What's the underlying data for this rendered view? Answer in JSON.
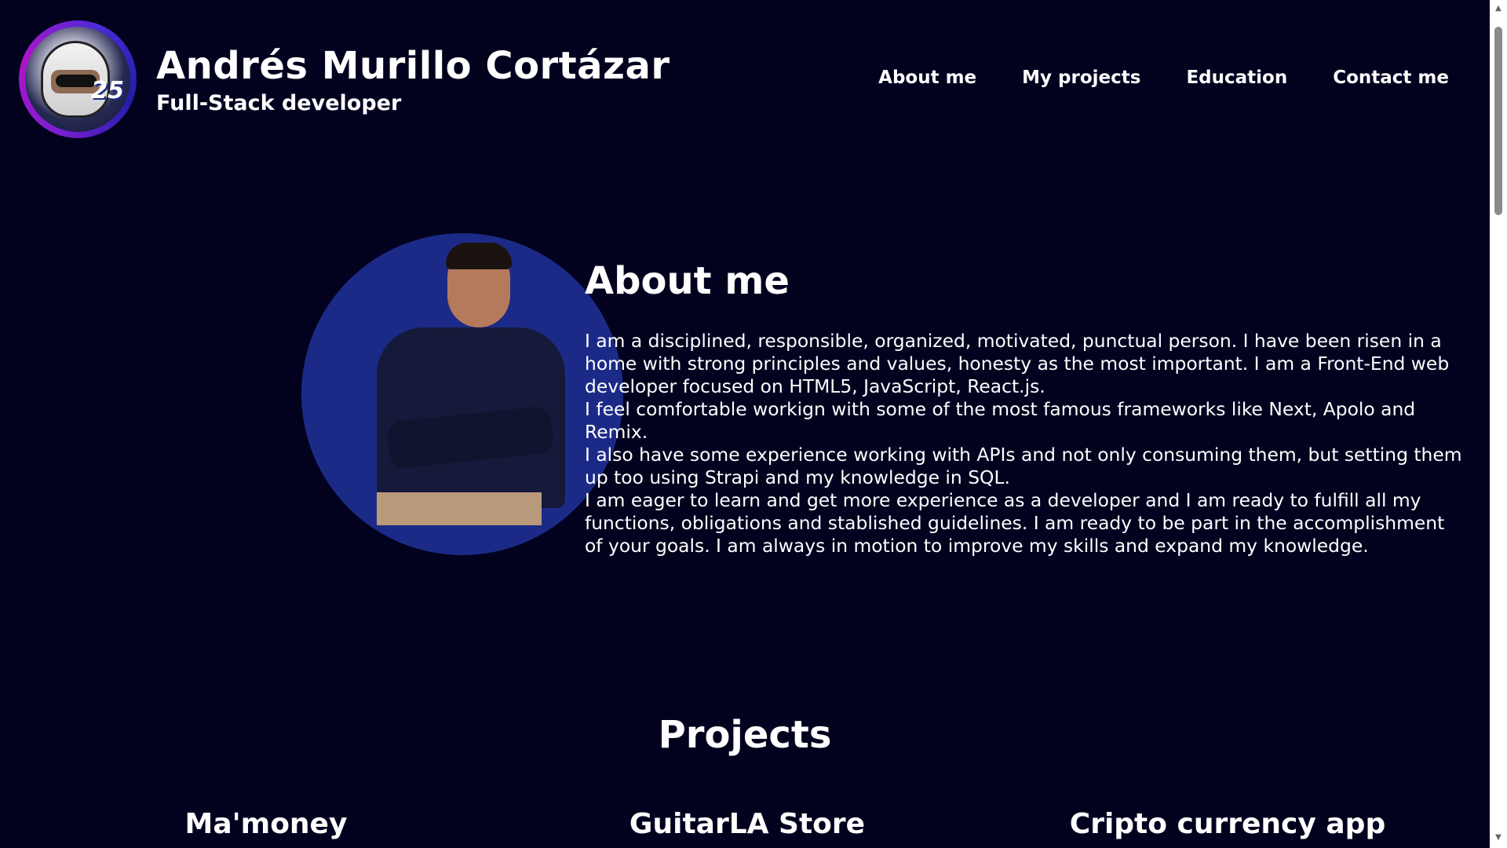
{
  "header": {
    "avatar_badge": "25",
    "name": "Andrés Murillo Cortázar",
    "role": "Full-Stack developer",
    "nav": [
      {
        "label": "About me"
      },
      {
        "label": "My projects"
      },
      {
        "label": "Education"
      },
      {
        "label": "Contact me"
      }
    ]
  },
  "about": {
    "title": "About me",
    "paragraphs": [
      "I am a disciplined, responsible, organized, motivated, punctual person. I have been risen in a home with strong principles and values, honesty as the most important. I am a Front-End web developer focused on HTML5, JavaScript, React.js.",
      "I feel comfortable workign with some of the most famous frameworks like Next, Apolo and Remix.",
      "I also have some experience working with APIs and not only consuming them, but setting them up too using Strapi and my knowledge in SQL.",
      "I am eager to learn and get more experience as a developer and I am ready to fulfill all my functions, obligations and stablished guidelines. I am ready to be part in the accomplishment of your goals. I am always in motion to improve my skills and expand my knowledge."
    ]
  },
  "projects": {
    "title": "Projects",
    "items": [
      {
        "name": "Ma'money"
      },
      {
        "name": "GuitarLA Store"
      },
      {
        "name": "Cripto currency app"
      }
    ]
  },
  "colors": {
    "background": "#02021f",
    "portrait_circle": "#1c2a87",
    "text": "#ffffff"
  }
}
